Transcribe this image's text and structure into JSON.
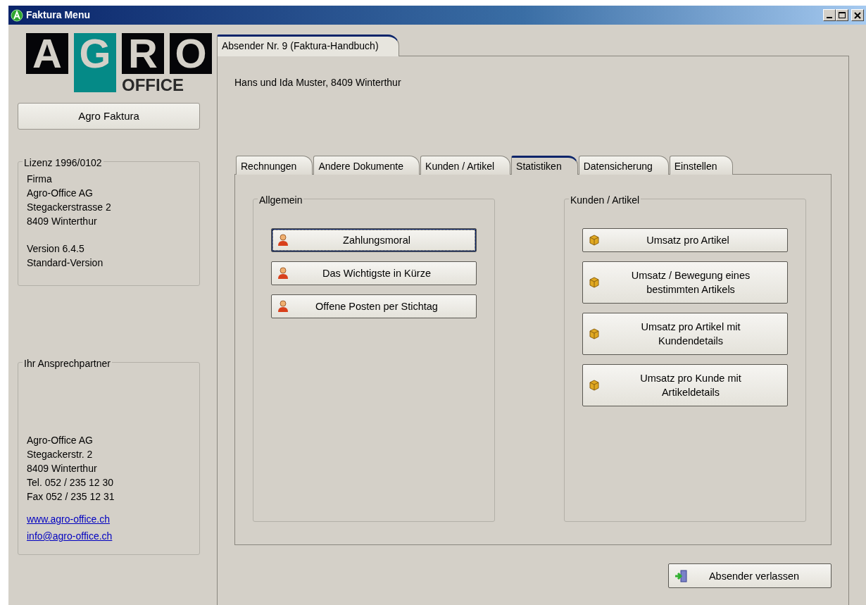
{
  "window": {
    "title": "Faktura Menu"
  },
  "sidebar": {
    "logo": {
      "letters": [
        "A",
        "G",
        "R",
        "O"
      ],
      "subtitle": "OFFICE"
    },
    "product_button": "Agro Faktura",
    "license": {
      "legend": "Lizenz 1996/0102",
      "blocks": [
        [
          "Firma",
          "Agro-Office AG",
          "Stegackerstrasse 2",
          "8409 Winterthur"
        ],
        [
          "Version 6.4.5",
          "Standard-Version"
        ]
      ]
    },
    "contact": {
      "legend": "Ihr Ansprechpartner",
      "lines": [
        "Agro-Office AG",
        "Stegackerstr. 2",
        "8409 Winterthur",
        "Tel. 052 / 235 12 30",
        "Fax 052 / 235 12 31"
      ],
      "links": [
        "www.agro-office.ch",
        "info@agro-office.ch"
      ]
    }
  },
  "main": {
    "outer_tab": {
      "label": "Absender Nr. 9 (Faktura-Handbuch)",
      "selected": true
    },
    "sender": "Hans und Ida Muster, 8409 Winterthur",
    "tabs": [
      {
        "label": "Rechnungen",
        "selected": false
      },
      {
        "label": "Andere Dokumente",
        "selected": false
      },
      {
        "label": "Kunden / Artikel",
        "selected": false
      },
      {
        "label": "Statistiken",
        "selected": true
      },
      {
        "label": "Datensicherung",
        "selected": false
      },
      {
        "label": "Einstellen",
        "selected": false
      }
    ],
    "groups": [
      {
        "legend": "Allgemein",
        "buttons": [
          {
            "label": "Zahlungsmoral",
            "kind": "person",
            "focused": true
          },
          {
            "label": "Das Wichtigste in Kürze",
            "kind": "person",
            "focused": false
          },
          {
            "label": "Offene Posten per Stichtag",
            "kind": "person",
            "focused": false
          }
        ]
      },
      {
        "legend": "Kunden / Artikel",
        "buttons": [
          {
            "label": "Umsatz pro Artikel",
            "kind": "package",
            "focused": false
          },
          {
            "label": "Umsatz / Bewegung eines bestimmten Artikels",
            "kind": "package",
            "focused": false
          },
          {
            "label": "Umsatz pro Artikel mit Kundendetails",
            "kind": "package",
            "focused": false
          },
          {
            "label": "Umsatz pro Kunde mit Artikeldetails",
            "kind": "package",
            "focused": false
          }
        ]
      }
    ],
    "exit_button": {
      "label": "Absender verlassen"
    }
  }
}
